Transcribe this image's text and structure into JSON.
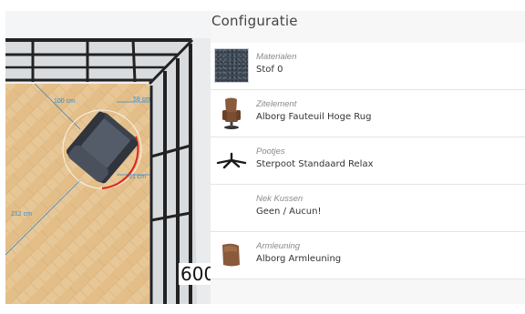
{
  "scene": {
    "overlay_number": "600",
    "dimensions": [
      "100 cm",
      "59 cm",
      "91 cm",
      "212 cm"
    ]
  },
  "panel": {
    "title": "Configuratie",
    "rows": [
      {
        "category": "Materialen",
        "value": "Stof 0",
        "thumb": "fabric-swatch"
      },
      {
        "category": "Zitelement",
        "value": "Alborg Fauteuil Hoge Rug",
        "thumb": "armchair-icon"
      },
      {
        "category": "Pootjes",
        "value": "Sterpoot Standaard Relax",
        "thumb": "star-base-icon"
      },
      {
        "category": "Nek Kussen",
        "value": "Geen / Aucun!",
        "thumb": ""
      },
      {
        "category": "Armleuning",
        "value": "Alborg Armleuning",
        "thumb": "armrest-icon"
      }
    ]
  },
  "colors": {
    "floor": "#e8c796",
    "window_frame": "#222222",
    "dimension_line": "#2e8bd6",
    "rotation_arc": "#d9251c",
    "chair": "#4d5461"
  }
}
